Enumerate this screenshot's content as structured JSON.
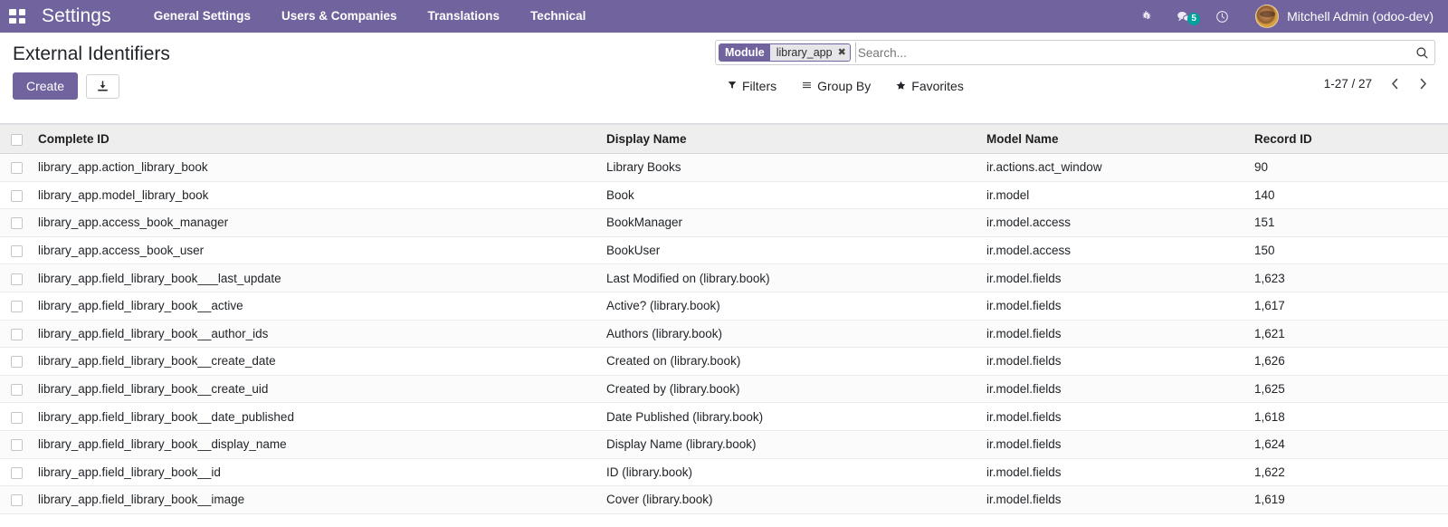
{
  "navbar": {
    "apps_icon": "apps-grid-icon",
    "brand": "Settings",
    "menu": [
      {
        "label": "General Settings"
      },
      {
        "label": "Users & Companies"
      },
      {
        "label": "Translations"
      },
      {
        "label": "Technical"
      }
    ],
    "icons": [
      {
        "name": "bug-icon"
      },
      {
        "name": "messages-icon",
        "badge": "5"
      },
      {
        "name": "activity-clock-icon"
      }
    ],
    "user": "Mitchell Admin (odoo-dev)",
    "accent_color": "#71639e",
    "badge_color": "#00a09d"
  },
  "control_panel": {
    "title": "External Identifiers",
    "create_label": "Create",
    "import_icon": "import-download-icon",
    "search": {
      "facet_label": "Module",
      "facet_value": "library_app",
      "facet_remove_icon": "close-icon",
      "placeholder": "Search...",
      "value": "",
      "search_icon": "search-icon"
    },
    "dropdowns": [
      {
        "label": "Filters",
        "icon": "filter-funnel-icon"
      },
      {
        "label": "Group By",
        "icon": "hamburger-lines-icon"
      },
      {
        "label": "Favorites",
        "icon": "star-icon"
      }
    ],
    "pager": {
      "range": "1-27 / 27",
      "prev_icon": "chevron-left-icon",
      "next_icon": "chevron-right-icon"
    }
  },
  "table": {
    "columns": [
      "Complete ID",
      "Display Name",
      "Model Name",
      "Record ID"
    ],
    "rows": [
      {
        "complete_id": "library_app.action_library_book",
        "display_name": "Library Books",
        "model_name": "ir.actions.act_window",
        "record_id": "90"
      },
      {
        "complete_id": "library_app.model_library_book",
        "display_name": "Book",
        "model_name": "ir.model",
        "record_id": "140"
      },
      {
        "complete_id": "library_app.access_book_manager",
        "display_name": "BookManager",
        "model_name": "ir.model.access",
        "record_id": "151"
      },
      {
        "complete_id": "library_app.access_book_user",
        "display_name": "BookUser",
        "model_name": "ir.model.access",
        "record_id": "150"
      },
      {
        "complete_id": "library_app.field_library_book___last_update",
        "display_name": "Last Modified on (library.book)",
        "model_name": "ir.model.fields",
        "record_id": "1,623"
      },
      {
        "complete_id": "library_app.field_library_book__active",
        "display_name": "Active? (library.book)",
        "model_name": "ir.model.fields",
        "record_id": "1,617"
      },
      {
        "complete_id": "library_app.field_library_book__author_ids",
        "display_name": "Authors (library.book)",
        "model_name": "ir.model.fields",
        "record_id": "1,621"
      },
      {
        "complete_id": "library_app.field_library_book__create_date",
        "display_name": "Created on (library.book)",
        "model_name": "ir.model.fields",
        "record_id": "1,626"
      },
      {
        "complete_id": "library_app.field_library_book__create_uid",
        "display_name": "Created by (library.book)",
        "model_name": "ir.model.fields",
        "record_id": "1,625"
      },
      {
        "complete_id": "library_app.field_library_book__date_published",
        "display_name": "Date Published (library.book)",
        "model_name": "ir.model.fields",
        "record_id": "1,618"
      },
      {
        "complete_id": "library_app.field_library_book__display_name",
        "display_name": "Display Name (library.book)",
        "model_name": "ir.model.fields",
        "record_id": "1,624"
      },
      {
        "complete_id": "library_app.field_library_book__id",
        "display_name": "ID (library.book)",
        "model_name": "ir.model.fields",
        "record_id": "1,622"
      },
      {
        "complete_id": "library_app.field_library_book__image",
        "display_name": "Cover (library.book)",
        "model_name": "ir.model.fields",
        "record_id": "1,619"
      }
    ]
  }
}
